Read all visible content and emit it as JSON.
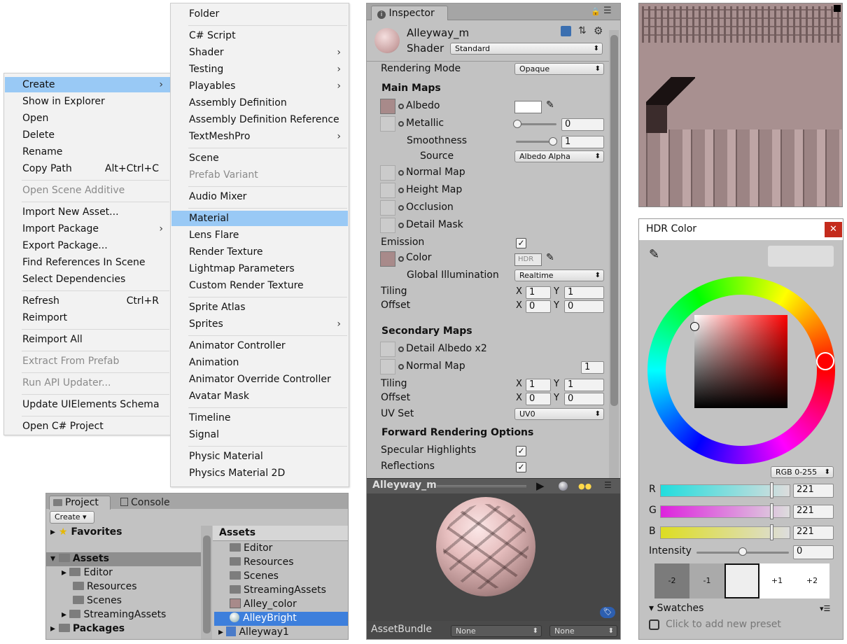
{
  "context_menu": {
    "items": [
      {
        "label": "Create",
        "sel": true,
        "arrow": true
      },
      {
        "label": "Show in Explorer"
      },
      {
        "label": "Open"
      },
      {
        "label": "Delete"
      },
      {
        "label": "Rename"
      },
      {
        "label": "Copy Path",
        "shortcut": "Alt+Ctrl+C"
      },
      {
        "label": "Open Scene Additive",
        "dis": true
      },
      {
        "label": "Import New Asset..."
      },
      {
        "label": "Import Package",
        "arrow": true
      },
      {
        "label": "Export Package..."
      },
      {
        "label": "Find References In Scene"
      },
      {
        "label": "Select Dependencies"
      },
      {
        "label": "Refresh",
        "shortcut": "Ctrl+R"
      },
      {
        "label": "Reimport"
      },
      {
        "label": "Reimport All"
      },
      {
        "label": "Extract From Prefab",
        "dis": true
      },
      {
        "label": "Run API Updater...",
        "dis": true
      },
      {
        "label": "Update UIElements Schema"
      },
      {
        "label": "Open C# Project"
      }
    ]
  },
  "create_menu": {
    "items": [
      {
        "label": "Folder"
      },
      {
        "label": "C# Script"
      },
      {
        "label": "Shader",
        "arrow": true
      },
      {
        "label": "Testing",
        "arrow": true
      },
      {
        "label": "Playables",
        "arrow": true
      },
      {
        "label": "Assembly Definition"
      },
      {
        "label": "Assembly Definition Reference"
      },
      {
        "label": "TextMeshPro",
        "arrow": true
      },
      {
        "label": "Scene"
      },
      {
        "label": "Prefab Variant",
        "dis": true
      },
      {
        "label": "Audio Mixer"
      },
      {
        "label": "Material",
        "sel": true
      },
      {
        "label": "Lens Flare"
      },
      {
        "label": "Render Texture"
      },
      {
        "label": "Lightmap Parameters"
      },
      {
        "label": "Custom Render Texture"
      },
      {
        "label": "Sprite Atlas"
      },
      {
        "label": "Sprites",
        "arrow": true
      },
      {
        "label": "Animator Controller"
      },
      {
        "label": "Animation"
      },
      {
        "label": "Animator Override Controller"
      },
      {
        "label": "Avatar Mask"
      },
      {
        "label": "Timeline"
      },
      {
        "label": "Signal"
      },
      {
        "label": "Physic Material"
      },
      {
        "label": "Physics Material 2D"
      }
    ]
  },
  "inspector": {
    "tab": "Inspector",
    "material_name": "Alleyway_m",
    "shader_label": "Shader",
    "shader_value": "Standard",
    "rendering_mode_label": "Rendering Mode",
    "rendering_mode": "Opaque",
    "main_maps": "Main Maps",
    "albedo": "Albedo",
    "metallic": "Metallic",
    "metallic_value": "0",
    "smoothness": "Smoothness",
    "smoothness_value": "1",
    "source": "Source",
    "source_value": "Albedo Alpha",
    "normal_map": "Normal Map",
    "height_map": "Height Map",
    "occlusion": "Occlusion",
    "detail_mask": "Detail Mask",
    "emission": "Emission",
    "color": "Color",
    "hdr": "HDR",
    "gi": "Global Illumination",
    "gi_value": "Realtime",
    "tiling": "Tiling",
    "offset": "Offset",
    "x": "X",
    "y": "Y",
    "tiling_x": "1",
    "tiling_y": "1",
    "offset_x": "0",
    "offset_y": "0",
    "secondary_maps": "Secondary Maps",
    "detail_albedo": "Detail Albedo x2",
    "normal_map2": "Normal Map",
    "normal_scale": "1",
    "tiling2_x": "1",
    "tiling2_y": "1",
    "offset2_x": "0",
    "offset2_y": "0",
    "uv_set": "UV Set",
    "uv_value": "UV0",
    "forward": "Forward Rendering Options",
    "specular": "Specular Highlights",
    "reflections": "Reflections",
    "preview_title": "Alleyway_m",
    "assetbundle": "AssetBundle",
    "ab_name": "None",
    "ab_variant": "None"
  },
  "project": {
    "tab_project": "Project",
    "tab_console": "Console",
    "create": "Create",
    "favorites": "Favorites",
    "assets": "Assets",
    "tree": [
      "Editor",
      "Resources",
      "Scenes",
      "StreamingAssets"
    ],
    "packages": "Packages",
    "assets_header": "Assets",
    "files": [
      "Editor",
      "Resources",
      "Scenes",
      "StreamingAssets",
      "Alley_color",
      "AlleyBright",
      "Alleyway1"
    ]
  },
  "hdr_color": {
    "title": "HDR Color",
    "mode": "RGB 0-255",
    "r_label": "R",
    "g_label": "G",
    "b_label": "B",
    "r": "221",
    "g": "221",
    "b": "221",
    "intensity_label": "Intensity",
    "intensity": "0",
    "stops": [
      "-2",
      "-1",
      "",
      "+1",
      "+2"
    ],
    "swatches": "Swatches",
    "add_preset": "Click to add new preset",
    "hue_color": "#ff0000"
  }
}
